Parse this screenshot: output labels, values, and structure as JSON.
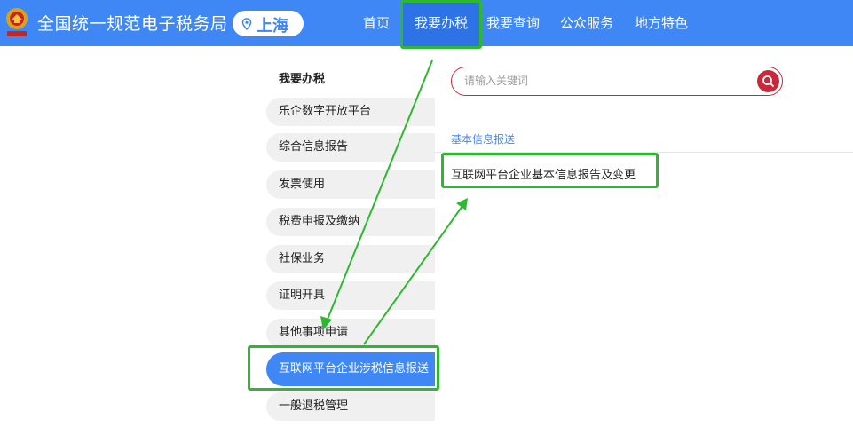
{
  "header": {
    "site_title": "全国统一规范电子税务局",
    "region": "上海",
    "nav": [
      {
        "label": "首页"
      },
      {
        "label": "我要办税"
      },
      {
        "label": "我要查询"
      },
      {
        "label": "公众服务"
      },
      {
        "label": "地方特色"
      }
    ]
  },
  "sidebar": {
    "heading": "我要办税",
    "items": [
      {
        "label": "乐企数字开放平台"
      },
      {
        "label": "综合信息报告"
      },
      {
        "label": "发票使用"
      },
      {
        "label": "税费申报及缴纳"
      },
      {
        "label": "社保业务"
      },
      {
        "label": "证明开具"
      },
      {
        "label": "其他事项申请"
      },
      {
        "label": "互联网平台企业涉税信息报送"
      },
      {
        "label": "一般退税管理"
      }
    ]
  },
  "search": {
    "placeholder": "请输入关键词"
  },
  "content": {
    "section_title": "基本信息报送",
    "result": "互联网平台企业基本信息报告及变更"
  },
  "colors": {
    "brand_blue": "#3f87f5",
    "search_red": "#c8283a",
    "highlight_green": "#2eb830"
  }
}
